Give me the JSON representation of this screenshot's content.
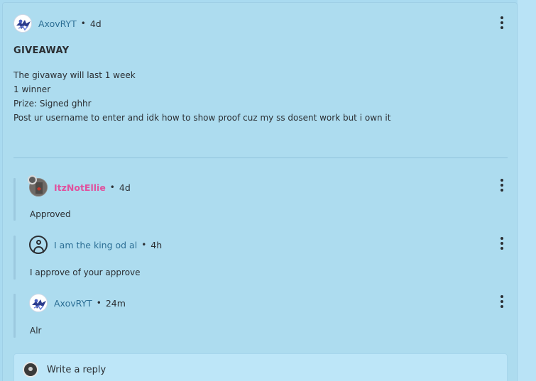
{
  "post": {
    "author": "AxovRYT",
    "separator": "•",
    "time": "4d",
    "title": "GIVEAWAY",
    "lines": [
      "The givaway will last 1 week",
      "1 winner",
      "Prize: Signed ghhr",
      "Post ur username to enter and idk how to show proof cuz my ss dosent work but i own it"
    ]
  },
  "comments": [
    {
      "author": "ItzNotEllie",
      "time": "4d",
      "text": "Approved",
      "role": "moderator"
    },
    {
      "author": "I am the king od al",
      "time": "4h",
      "text": "I approve of your approve"
    },
    {
      "author": "AxovRYT",
      "time": "24m",
      "text": "Alr"
    }
  ],
  "reply": {
    "placeholder": "Write a reply"
  },
  "icons": {
    "menu": "more-vertical-icon",
    "default_avatar": "user-circle-icon",
    "mod_badge": "gear-icon"
  },
  "colors": {
    "page_bg": "#a9daf0",
    "link": "#2c6f95",
    "moderator": "#e0529e"
  }
}
